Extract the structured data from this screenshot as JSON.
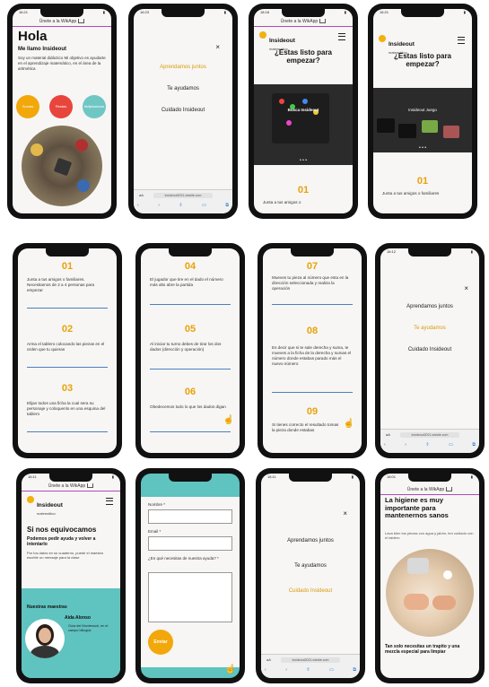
{
  "status": {
    "time1": "16:21",
    "time2": "16:23",
    "time3": "18:18",
    "time4": "16:12",
    "time5": "16:11",
    "time6": "18:01"
  },
  "whatsapp": {
    "label": "Únete a la WikApp"
  },
  "brand": {
    "name": "Insideout",
    "sub": "matemático"
  },
  "phone1": {
    "title": "Hola",
    "subtitle": "Me llamo Insideout",
    "body": "Soy un material didáctico Mi objetivo es ayudarte en el aprendizaje matemático, en el área de la aritmética",
    "buttons": [
      "Sumas",
      "Restas",
      "Multiplicaciones"
    ],
    "button_colors": [
      "#f2a80a",
      "#e8453c",
      "#6fc7c4"
    ]
  },
  "menu": {
    "items": [
      "Aprendamos juntos",
      "Te ayudamos",
      "Cuidado Insideout"
    ],
    "close": "×"
  },
  "browser": {
    "aa": "aA",
    "url": "insideout2021.wixsite.com"
  },
  "phone3": {
    "heading": "¿Estas listo para empezar?",
    "video_title": "Busca Insideout",
    "step_num": "01",
    "step_text": "Junta a tus amigos o"
  },
  "phone4": {
    "heading": "¿Estas listo para empezar?",
    "video_title": "Insideout Juego",
    "step_num": "01",
    "step_text": "Junta a tus amigos o familiares"
  },
  "steps": [
    {
      "num": "01",
      "text": "Junta a tus amigos o familiares. Necesitamos de 2 a 4 personas para empezar"
    },
    {
      "num": "02",
      "text": "Arma el tablero colocando las piezas en el orden que tu quieras"
    },
    {
      "num": "03",
      "text": "Elijan todos una ficha la cual sera su personaje y coloquenlo en una esquina del tablero"
    },
    {
      "num": "04",
      "text": "El jugador que tire en el dado el número más alto abre la partida"
    },
    {
      "num": "05",
      "text": "Al iniciar tu turno debes de tirar los dos dados (dirección y operación)"
    },
    {
      "num": "06",
      "text": "Obedecemos todo lo que los dados digan"
    },
    {
      "num": "07",
      "text": "Mueves tu pieza al número que esta en la dirección seleccionada y realiza la operación"
    },
    {
      "num": "08",
      "text": "Es decir que si te sale derecha y suma, te mueves a la ficha de la derecha y sumas el número donde estabas parado más el nuevo número"
    },
    {
      "num": "09",
      "text": "Si tienes correcto el resultado tomas la pieza donde estabas"
    }
  ],
  "phone9": {
    "heading": "Si nos equivocamos",
    "sub": "Podemos pedir ayuda y volver a intentarlo",
    "body": "Por los datos en su cuaderno, puede el maestro escribir un mensaje para la clase",
    "teachers_title": "Nuestras maestras",
    "teacher_name": "Aida Alonso",
    "teacher_text": "Guía del Montessori, en el campo bilingüe."
  },
  "phone10": {
    "name_label": "Nombre *",
    "email_label": "Email *",
    "msg_label": "¿En qué necesitas de nuestra ayuda? *",
    "send": "Enviar"
  },
  "phone12": {
    "heading": "La higiene es muy importante para mantenernos sanos",
    "body": "Lava bien tus piezas con agua y jabón, ten cuidado con el tablero",
    "footer": "Tan solo necesitas un trapito y una mezcla especial para limpiar"
  },
  "colors": {
    "accent": "#e8a20b",
    "line": "#4b7fc0",
    "teal": "#5fc3c0",
    "purple": "#b04ab8"
  }
}
